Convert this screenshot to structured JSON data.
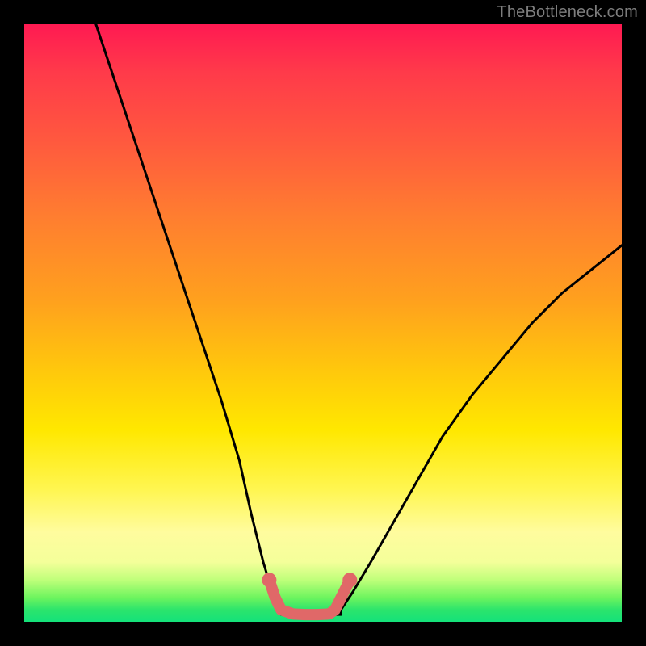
{
  "watermark": "TheBottleneck.com",
  "chart_data": {
    "type": "line",
    "title": "",
    "xlabel": "",
    "ylabel": "",
    "xlim": [
      0,
      100
    ],
    "ylim": [
      0,
      100
    ],
    "grid": false,
    "legend": false,
    "annotations": [],
    "series": [
      {
        "name": "black-curve-left",
        "color": "#000000",
        "x": [
          12,
          15,
          18,
          21,
          24,
          27,
          30,
          33,
          36,
          38,
          40,
          41.5,
          43
        ],
        "y": [
          100,
          91,
          82,
          73,
          64,
          55,
          46,
          37,
          27,
          18,
          10,
          5,
          2
        ]
      },
      {
        "name": "black-curve-right",
        "color": "#000000",
        "x": [
          53,
          55,
          58,
          62,
          66,
          70,
          75,
          80,
          85,
          90,
          95,
          100
        ],
        "y": [
          2,
          5,
          10,
          17,
          24,
          31,
          38,
          44,
          50,
          55,
          59,
          63
        ]
      },
      {
        "name": "pink-bottom-segment",
        "color": "#e06868",
        "x": [
          41,
          42,
          43,
          45,
          47,
          49,
          51,
          52,
          53,
          54.5
        ],
        "y": [
          7,
          4,
          2,
          1.3,
          1.2,
          1.2,
          1.3,
          2,
          4,
          7
        ]
      }
    ],
    "markers": [
      {
        "series": "pink-bottom-segment",
        "x": 41,
        "y": 7
      },
      {
        "series": "pink-bottom-segment",
        "x": 54.5,
        "y": 7
      }
    ]
  },
  "colors": {
    "gradient_top": "#ff1a52",
    "gradient_mid": "#ffe800",
    "gradient_bottom": "#14e27a",
    "curve": "#000000",
    "accent": "#e06868",
    "frame": "#000000",
    "watermark": "#7d7d7d"
  }
}
